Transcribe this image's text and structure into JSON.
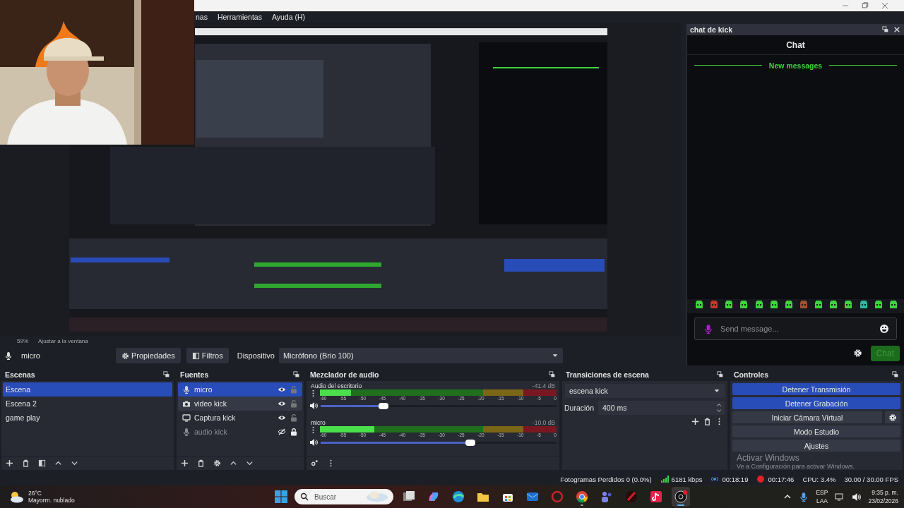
{
  "menu": [
    "nas",
    "Herramientas",
    "Ayuda (H)"
  ],
  "preview_bar": {
    "zoom": "59%",
    "fit": "Ajustar a la ventana"
  },
  "context_bar": {
    "source": "micro",
    "buttons": [
      {
        "label": "Propiedades",
        "kind": "gear"
      },
      {
        "label": "Filtros",
        "kind": "filter"
      }
    ],
    "device_label": "Dispositivo",
    "device": "Micrófono (Brio 100)"
  },
  "chat_dock": {
    "title": "chat de kick",
    "heading": "Chat",
    "divider": "New messages",
    "emotes": [
      {
        "color": "#3fd43f"
      },
      {
        "color": "#c0392b"
      },
      {
        "color": "#3fd43f"
      },
      {
        "color": "#3fd43f"
      },
      {
        "color": "#3fd43f"
      },
      {
        "color": "#3fd43f"
      },
      {
        "color": "#3fd43f"
      },
      {
        "color": "#a0522d"
      },
      {
        "color": "#3fd43f"
      },
      {
        "color": "#3fd43f"
      },
      {
        "color": "#3fd43f"
      },
      {
        "color": "#2fb8a0"
      },
      {
        "color": "#3fd43f"
      },
      {
        "color": "#3fd43f"
      }
    ],
    "input": {
      "placeholder": "Send message..."
    },
    "send": "Chat"
  },
  "scenes": {
    "title": "Escenas",
    "items": [
      {
        "name": "Escena",
        "selected": true
      },
      {
        "name": "Escena 2",
        "selected": false
      },
      {
        "name": "game play",
        "selected": false
      }
    ]
  },
  "sources": {
    "title": "Fuentes",
    "items": [
      {
        "name": "micro",
        "kind": "mic",
        "visible": true,
        "locked": false,
        "selected": true,
        "hovered": false
      },
      {
        "name": "video kick",
        "kind": "camera",
        "visible": true,
        "locked": false,
        "selected": false,
        "hovered": true
      },
      {
        "name": "Captura kick",
        "kind": "monitor",
        "visible": true,
        "locked": false,
        "selected": false,
        "hovered": false
      },
      {
        "name": "audio kick",
        "kind": "mic",
        "visible": false,
        "locked": true,
        "selected": false,
        "hovered": false
      }
    ]
  },
  "mixer": {
    "title": "Mezclador de audio",
    "channels": [
      {
        "name": "Audio del escritorio",
        "reading": "-41.4 dB",
        "meter": {
          "level": 0.13
        },
        "volume": {
          "level": 0.28
        },
        "scale": [
          "-60",
          "-55",
          "-50",
          "-45",
          "-40",
          "-35",
          "-30",
          "-25",
          "-20",
          "-15",
          "-10",
          "-5",
          "0"
        ]
      },
      {
        "name": "micro",
        "reading": "-10.0 dB",
        "meter": {
          "level": 0.23
        },
        "volume": {
          "level": 0.65
        },
        "scale": [
          "-60",
          "-55",
          "-50",
          "-45",
          "-40",
          "-35",
          "-30",
          "-25",
          "-20",
          "-15",
          "-10",
          "-5",
          "0"
        ]
      }
    ]
  },
  "transitions": {
    "title": "Transiciones de escena",
    "transition": "escena kick",
    "duration_label": "Duración",
    "duration": "400 ms"
  },
  "controls": {
    "title": "Controles",
    "buttons": [
      {
        "label": "Detener Transmisión",
        "active": true,
        "settings": false
      },
      {
        "label": "Detener Grabación",
        "active": true,
        "settings": false
      },
      {
        "label": "Iniciar Cámara Virtual",
        "active": false,
        "settings": true
      },
      {
        "label": "Modo Estudio",
        "active": false,
        "settings": false
      },
      {
        "label": "Ajustes",
        "active": false,
        "settings": false
      }
    ]
  },
  "activation": {
    "title": "Activar Windows",
    "subtitle": "Ve a Configuración para activar Windows."
  },
  "status_bar": {
    "dropped": "Fotogramas Perdidos 0 (0.0%)",
    "bitrate": "6181 kbps",
    "stream_time": "00:18:19",
    "record_time": "00:17:46",
    "cpu": "CPU: 3.4%",
    "fps": "30.00 / 30.00 FPS"
  },
  "taskbar": {
    "weather": {
      "temp": "26°C",
      "desc": "Mayorm. nublado"
    },
    "search": {
      "placeholder": "Buscar"
    },
    "apps": [
      {
        "kind": "task-view",
        "running": false,
        "selected": false
      },
      {
        "kind": "swirl",
        "running": false,
        "selected": false
      },
      {
        "kind": "globe",
        "running": false,
        "selected": false
      },
      {
        "kind": "folder",
        "running": false,
        "selected": false
      },
      {
        "kind": "bag",
        "running": false,
        "selected": false
      },
      {
        "kind": "mail",
        "running": false,
        "selected": false
      },
      {
        "kind": "red-ring",
        "running": false,
        "selected": false
      },
      {
        "kind": "browser",
        "running": true,
        "selected": false
      },
      {
        "kind": "people",
        "running": false,
        "selected": false
      },
      {
        "kind": "red-swoosh",
        "running": false,
        "selected": false
      },
      {
        "kind": "note",
        "running": false,
        "selected": false
      },
      {
        "kind": "recorder",
        "running": true,
        "selected": true
      }
    ],
    "tray": {
      "lang": "ESP",
      "layout": "LAA",
      "time": "9:35 p. m.",
      "date": "23/02/2026"
    }
  }
}
